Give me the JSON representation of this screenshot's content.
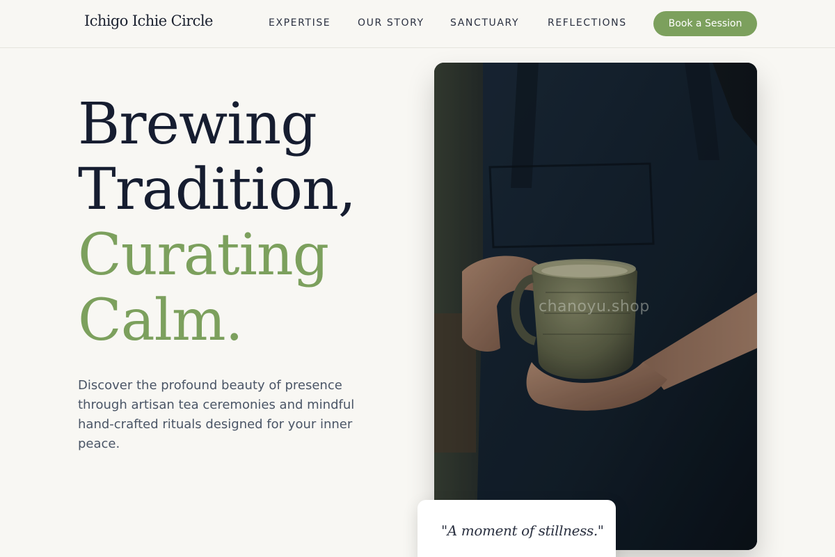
{
  "brand": {
    "name": "Ichigo Ichie Circle"
  },
  "nav": {
    "items": [
      {
        "label": "EXPERTISE"
      },
      {
        "label": "OUR STORY"
      },
      {
        "label": "SANCTUARY"
      },
      {
        "label": "REFLECTIONS"
      }
    ],
    "cta_label": "Book a Session"
  },
  "hero": {
    "headline_line1": "Brewing",
    "headline_line2": "Tradition,",
    "headline_line3": "Curating",
    "headline_line4": "Calm.",
    "lede": "Discover the profound beauty of presence through artisan tea ceremonies and mindful hand-crafted rituals designed for your inner peace."
  },
  "photo": {
    "watermark": "chanoyu.shop"
  },
  "quote": {
    "text": "\"A moment of stillness.\""
  },
  "colors": {
    "background": "#f8f7f3",
    "accent_green": "#7ca05d",
    "headline_dark": "#161d30",
    "body_text": "#4a5566"
  }
}
